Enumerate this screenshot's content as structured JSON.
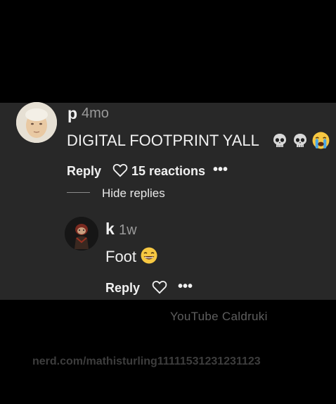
{
  "comment": {
    "username": "p",
    "age": "4mo",
    "text": "DIGITAL FOOTPRINT YALL",
    "emojis": [
      "skull-emoji",
      "skull-emoji",
      "crying-face-emoji"
    ],
    "actions": {
      "reply_label": "Reply",
      "reactions_label": "15 reactions",
      "more_label": "•••"
    },
    "hide_replies_label": "Hide replies"
  },
  "reply": {
    "username": "k",
    "age": "1w",
    "text": "Foot",
    "emoji": "grinning-smiling-emoji",
    "actions": {
      "reply_label": "Reply",
      "more_label": "•••"
    }
  },
  "watermarks": {
    "youtube": "YouTube Caldruki",
    "url": "nerd.com/mathisturling11111531231231123"
  },
  "colors": {
    "background": "#000000",
    "panel": "#282828",
    "text_primary": "#f1f1f1",
    "text_secondary": "#9a9a9a"
  }
}
